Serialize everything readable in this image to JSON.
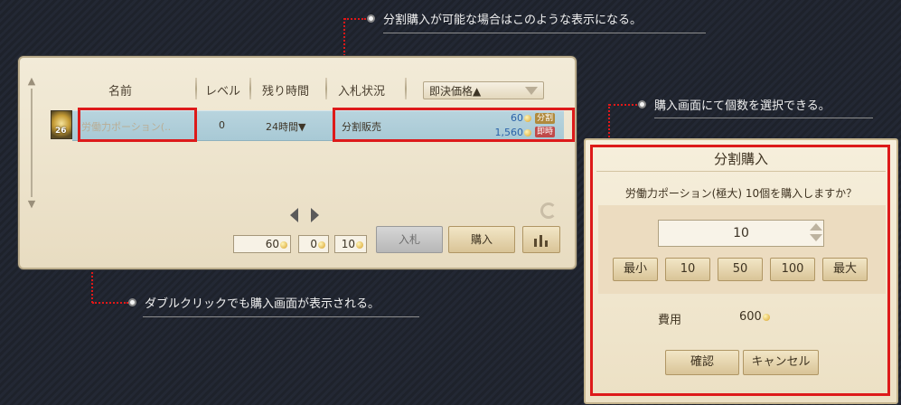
{
  "annotations": {
    "split_purchase": "分割購入が可能な場合はこのような表示になる。",
    "select_quantity": "購入画面にて個数を選択できる。",
    "double_click": "ダブルクリックでも購入画面が表示される。"
  },
  "auction": {
    "headers": {
      "name": "名前",
      "level": "レベル",
      "time_left": "残り時間",
      "bid_status": "入札状況"
    },
    "sort_select": "即決価格▲",
    "item": {
      "stack": "26",
      "name": "労働力ポーション(..",
      "level": "0",
      "time_left": "24時間▼",
      "status": "分割販売",
      "unit_price": "60",
      "instant_price": "1,560",
      "split_tag": "分割",
      "instant_tag": "即時"
    },
    "footer": {
      "bid_price": "60",
      "fee": "0",
      "deposit": "10",
      "bid_button": "入札",
      "buy_button": "購入"
    }
  },
  "dialog": {
    "title": "分割購入",
    "message": "労働力ポーション(極大) 10個を購入しますか？",
    "quantity": "10",
    "quick_buttons": [
      "最小",
      "10",
      "50",
      "100",
      "最大"
    ],
    "cost_label": "費用",
    "cost_value": "600",
    "confirm": "確認",
    "cancel": "キャンセル"
  },
  "colors": {
    "highlight": "#dd1a1a",
    "row_selected": "#a8c9d5",
    "price_text": "#2a62a8"
  }
}
